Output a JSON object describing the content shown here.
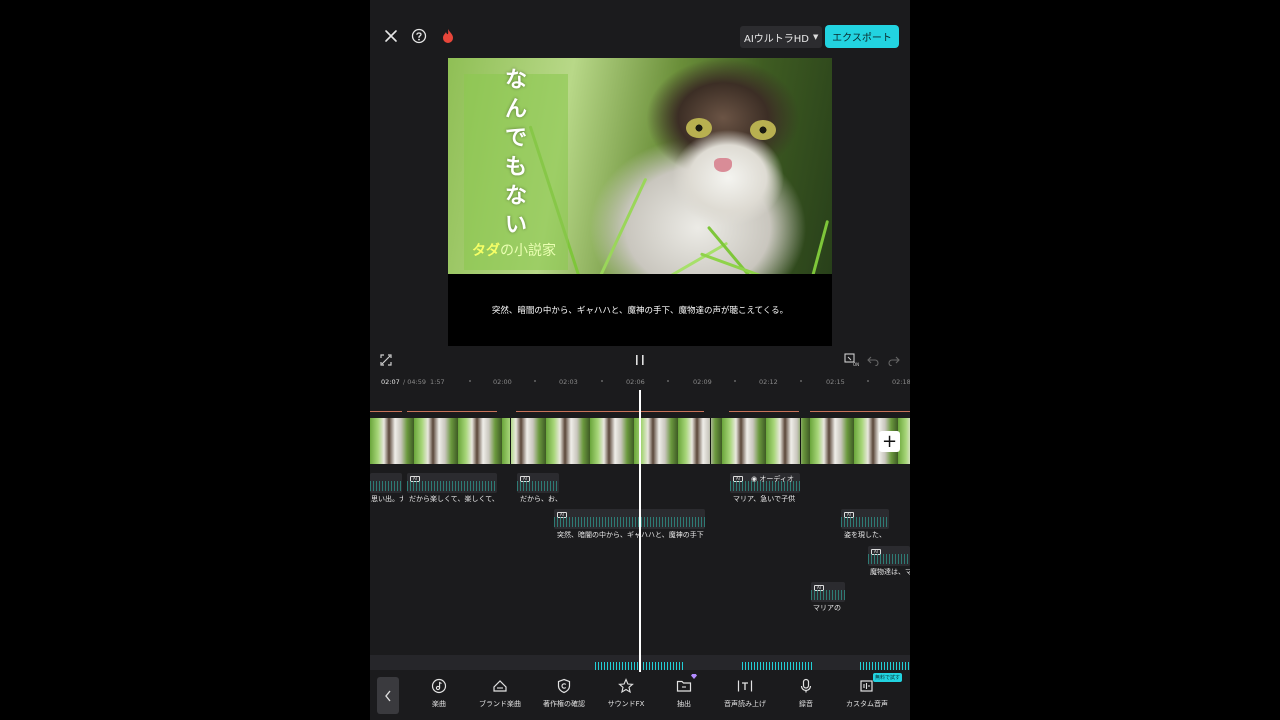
{
  "header": {
    "quality_label": "AIウルトラHD",
    "export_label": "エクスポート"
  },
  "preview": {
    "title_vertical": "なんでもない",
    "credit_prefix": "タダ",
    "credit_suffix": "の小説家",
    "subtitle": "突然、暗闇の中から、ギャハハと、魔神の手下、魔物達の声が聴こえてくる。"
  },
  "ruler": {
    "current_time": "02:07",
    "total_time": "/ 04:59",
    "ticks": [
      "1:57",
      "02:00",
      "02:03",
      "02:06",
      "02:09",
      "02:12",
      "02:15",
      "02:18"
    ]
  },
  "audio_clips": [
    {
      "label": "思い出。ナ"
    },
    {
      "label": "だから楽しくて、楽しくて、"
    },
    {
      "label": "だから、お、"
    },
    {
      "label": "マリア、急いで子供"
    },
    {
      "label": "突然、暗闇の中から、ギャハハと、魔神の手下"
    },
    {
      "label": "姿を現した、"
    },
    {
      "label": "魔物達は、マ"
    },
    {
      "label": "マリアの"
    }
  ],
  "audio_track_name": "オーディオ",
  "toolbar": {
    "items": [
      {
        "label": "楽曲",
        "icon": "music-note-icon"
      },
      {
        "label": "ブランド楽曲",
        "icon": "brand-music-icon"
      },
      {
        "label": "著作権の確認",
        "icon": "copyright-shield-icon"
      },
      {
        "label": "サウンドFX",
        "icon": "star-fx-icon"
      },
      {
        "label": "抽出",
        "icon": "folder-extract-icon"
      },
      {
        "label": "音声読み上げ",
        "icon": "text-to-speech-icon"
      },
      {
        "label": "録音",
        "icon": "microphone-icon"
      },
      {
        "label": "カスタム音声",
        "icon": "custom-voice-icon"
      }
    ],
    "free_badge": "無料で試す"
  },
  "colors": {
    "accent": "#22d3e0",
    "background": "#1b1b1d",
    "flame": "#e8463a"
  }
}
